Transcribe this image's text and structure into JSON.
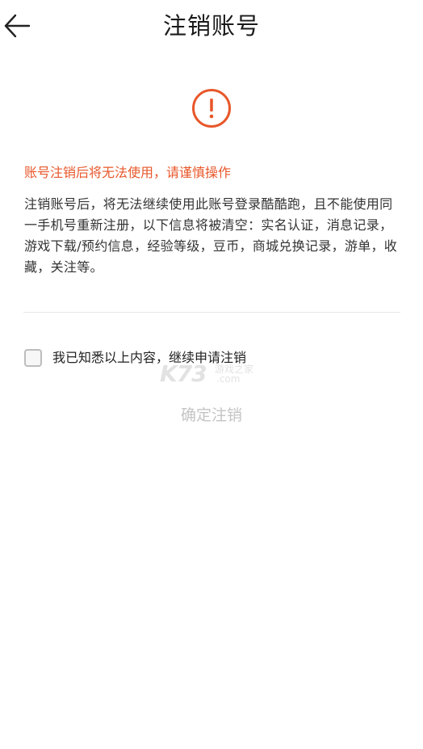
{
  "header": {
    "title": "注销账号",
    "back_icon": "arrow-left-icon"
  },
  "alert": {
    "icon": "exclamation-circle-icon",
    "color": "#e8572a"
  },
  "warning": "账号注销后将无法使用，请谨慎操作",
  "description": "注销账号后，将无法继续使用此账号登录酷酷跑，且不能使用同一手机号重新注册，以下信息将被清空：实名认证，消息记录，游戏下载/预约信息，经验等级，豆币，商城兑换记录，游单，收藏，关注等。",
  "agree": {
    "checked": false,
    "label": "我已知悉以上内容，继续申请注销"
  },
  "confirm_button": "确定注销",
  "watermark": {
    "main": "K73",
    "line1": "游戏之家",
    "line2": ".com"
  }
}
